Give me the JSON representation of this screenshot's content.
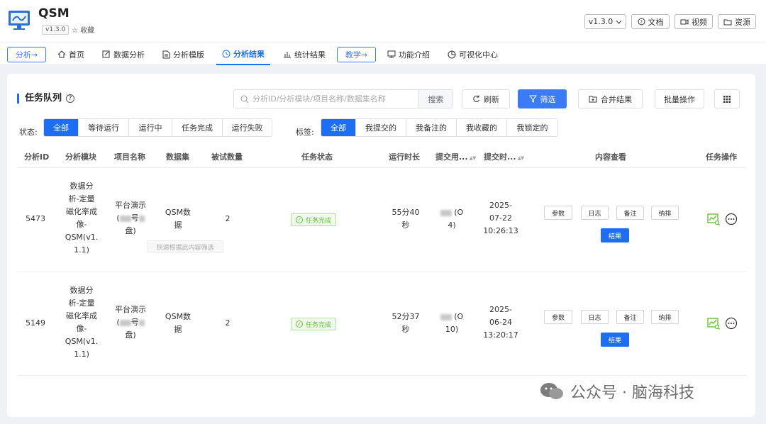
{
  "header": {
    "app_name": "QSM",
    "version_badge": "v1.3.0",
    "favorite": "☆ 收藏",
    "version_select": "v1.3.0",
    "docs": "文档",
    "video": "视频",
    "resources": "资源"
  },
  "nav": {
    "analysis_arrow": "分析→",
    "items": [
      "首页",
      "数据分析",
      "分析模版",
      "分析结果",
      "统计结果"
    ],
    "teaching_arrow": "教学→",
    "items2": [
      "功能介绍",
      "可视化中心"
    ]
  },
  "queue": {
    "title": "任务队列",
    "search_placeholder": "分析ID/分析模块/项目名称/数据集名称",
    "search_button": "搜索",
    "refresh": "刷新",
    "filter": "筛选",
    "merge": "合并结果",
    "batch": "批量操作",
    "status_label": "状态:",
    "status_options": [
      "全部",
      "等待运行",
      "运行中",
      "任务完成",
      "运行失败"
    ],
    "tag_label": "标签:",
    "tag_options": [
      "全部",
      "我提交的",
      "我备注的",
      "我收藏的",
      "我锁定的"
    ]
  },
  "table": {
    "columns": [
      "分析ID",
      "分析模块",
      "项目名称",
      "数据集",
      "被试数量",
      "任务状态",
      "运行时长",
      "提交用...",
      "提交时...",
      "内容查看",
      "任务操作"
    ],
    "tooltip": "快速根据此内容筛选",
    "view_buttons": [
      "参数",
      "日志",
      "备注",
      "纳排",
      "结果"
    ],
    "rows": [
      {
        "id": "5473",
        "module": [
          "数据分",
          "析-定量",
          "磁化率成",
          "像-",
          "QSM(v1.",
          "1.1)"
        ],
        "project": [
          "平台演示",
          "(",
          "号",
          "盘)"
        ],
        "dataset": [
          "QSM数",
          "据"
        ],
        "subjects": "2",
        "status": "任务完成",
        "duration": [
          "55分40",
          "秒"
        ],
        "user_suffix": [
          "(O",
          "4)"
        ],
        "date": [
          "2025-",
          "07-22",
          "10:26:13"
        ]
      },
      {
        "id": "5149",
        "module": [
          "数据分",
          "析-定量",
          "磁化率成",
          "像-",
          "QSM(v1.",
          "1.1)"
        ],
        "project": [
          "平台演示",
          "(",
          "号",
          "盘)"
        ],
        "dataset": [
          "QSM数",
          "据"
        ],
        "subjects": "2",
        "status": "任务完成",
        "duration": [
          "52分37",
          "秒"
        ],
        "user_suffix": [
          "(O",
          "10)"
        ],
        "date": [
          "2025-",
          "06-24",
          "13:20:17"
        ]
      }
    ]
  },
  "watermark": "公众号 · 脑海科技",
  "colors": {
    "primary": "#1e6ef5",
    "success": "#67c23a"
  }
}
